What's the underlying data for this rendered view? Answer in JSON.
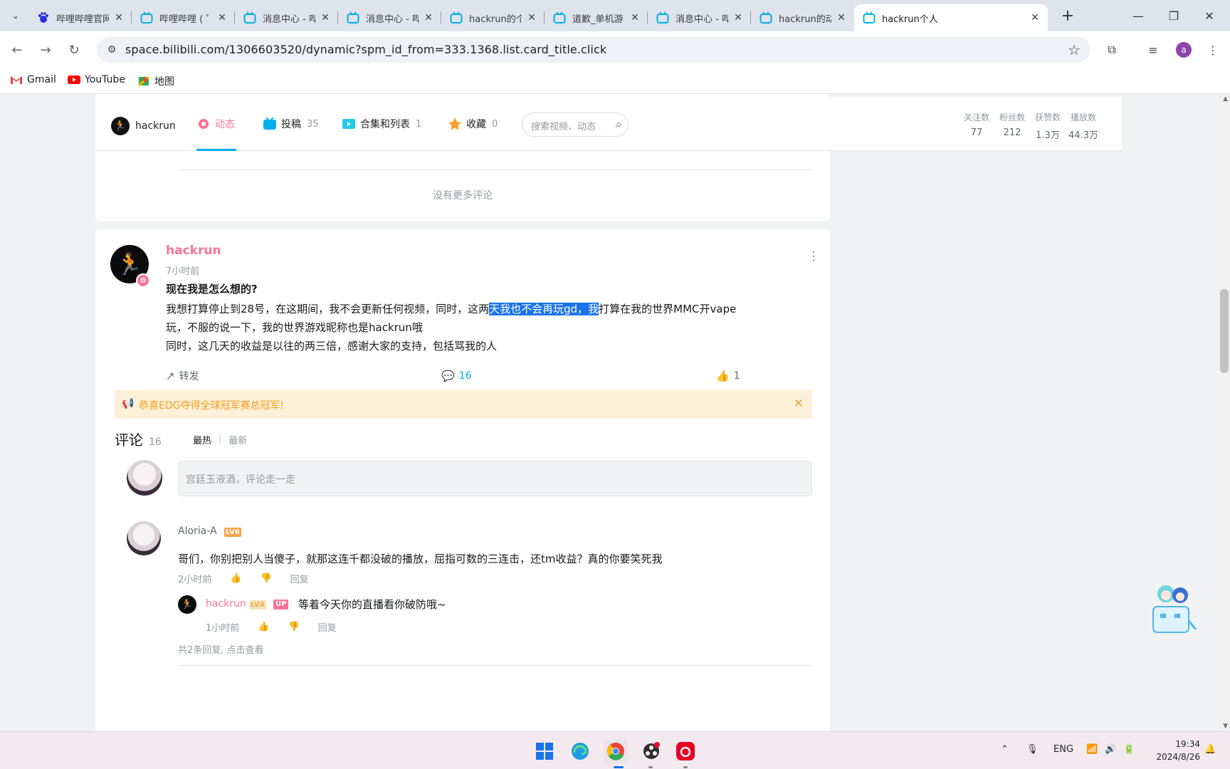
{
  "browser": {
    "tabs": [
      {
        "title": "哔哩哔哩官网",
        "favicon": "baidu-paw-icon"
      },
      {
        "title": "哔哩哔哩 ( ゜",
        "favicon": "bilibili-tv-icon"
      },
      {
        "title": "消息中心 - 哔",
        "favicon": "bilibili-tv-icon"
      },
      {
        "title": "消息中心 - 哔",
        "favicon": "bilibili-tv-icon"
      },
      {
        "title": "hackrun的个",
        "favicon": "bilibili-tv-icon"
      },
      {
        "title": "道歉_单机游",
        "favicon": "bilibili-tv-icon"
      },
      {
        "title": "消息中心 - 哔",
        "favicon": "bilibili-tv-icon"
      },
      {
        "title": "hackrun的动",
        "favicon": "bilibili-tv-icon"
      },
      {
        "title": "hackrun个人",
        "favicon": "bilibili-tv-icon",
        "active": true
      }
    ],
    "url": "space.bilibili.com/1306603520/dynamic?spm_id_from=333.1368.list.card_title.click",
    "profile_initial": "a",
    "bookmarks": [
      {
        "label": "Gmail",
        "icon": "gmail-icon"
      },
      {
        "label": "YouTube",
        "icon": "youtube-icon"
      },
      {
        "label": "地图",
        "icon": "maps-icon"
      }
    ]
  },
  "space_nav": {
    "username": "hackrun",
    "items": [
      {
        "label": "动态",
        "count": "",
        "active": true
      },
      {
        "label": "投稿",
        "count": "35"
      },
      {
        "label": "合集和列表",
        "count": "1"
      },
      {
        "label": "收藏",
        "count": "0"
      }
    ],
    "search_placeholder": "搜索视频、动态",
    "stats": [
      {
        "label": "关注数",
        "value": "77"
      },
      {
        "label": "粉丝数",
        "value": "212"
      },
      {
        "label": "获赞数",
        "value": "1.3万"
      },
      {
        "label": "播放数",
        "value": "44.3万"
      }
    ]
  },
  "previous_card": {
    "no_more": "没有更多评论"
  },
  "post": {
    "author": "hackrun",
    "time": "7小时前",
    "title": "现在我是怎么想的?",
    "line1_before": "我想打算停止到28号，在这期间，我不会更新任何视频，同时，这两",
    "line1_highlight": "天我也不会再玩gd，我",
    "line1_after": "打算在我的世界MMC开vape",
    "line2": "玩，不服的说一下，我的世界游戏昵称也是hackrun哦",
    "line3": "同时，这几天的收益是以往的两三倍，感谢大家的支持，包括骂我的人",
    "forward_label": "转发",
    "comment_count": "16",
    "like_count": "1"
  },
  "notice": {
    "text": "恭喜EDG夺得全球冠军赛总冠军!"
  },
  "comments": {
    "title": "评论",
    "count": "16",
    "sort_hot": "最热",
    "sort_new": "最新",
    "input_placeholder": "宫廷玉液酒，评论走一走",
    "list": [
      {
        "name": "Aloria-A",
        "level": "LV6",
        "text": "哥们，你别把别人当傻子，就那这连千都没破的播放，屈指可数的三连击，还tm收益？真的你要笑死我",
        "time": "2小时前",
        "reply_label": "回复",
        "reply": {
          "name": "hackrun",
          "level": "LV4",
          "tag": "UP",
          "text": "等着今天你的直播看你破防哦~",
          "time": "1小时前",
          "reply_label": "回复"
        },
        "view_more": "共2条回复, 点击查看"
      }
    ]
  },
  "taskbar": {
    "lang": "ENG",
    "time": "19:34",
    "date": "2024/8/26"
  }
}
